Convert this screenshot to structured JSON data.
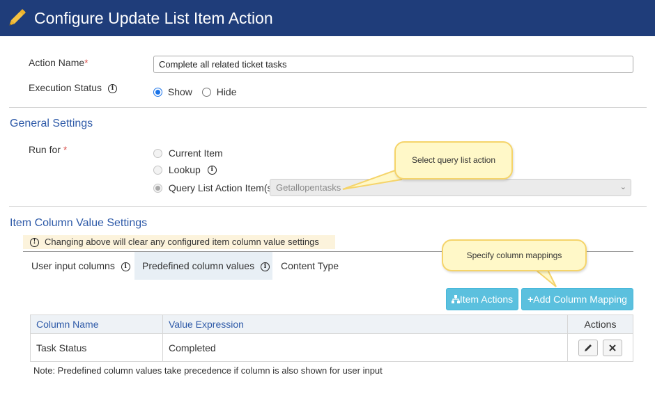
{
  "header": {
    "title": "Configure Update List Item Action",
    "icon": "pencil-icon"
  },
  "action_name": {
    "label": "Action Name",
    "required_mark": "*",
    "value": "Complete all related ticket tasks"
  },
  "execution_status": {
    "label": "Execution Status",
    "options": [
      "Show",
      "Hide"
    ],
    "selected": "Show"
  },
  "general_settings": {
    "title": "General Settings",
    "run_for": {
      "label": "Run for",
      "required_mark": "*",
      "options": [
        "Current Item",
        "Lookup",
        "Query List Action Item(s)"
      ],
      "selected": "Query List Action Item(s)"
    },
    "query_select": {
      "value": "Getallopentasks"
    }
  },
  "callouts": {
    "query": "Select query list action",
    "mapping": "Specify column mappings"
  },
  "item_column": {
    "title": "Item Column Value Settings",
    "warning": "Changing above will clear any configured item column value settings",
    "tabs": [
      "User input columns",
      "Predefined column values",
      "Content Type"
    ],
    "active_tab": "Predefined column values",
    "buttons": {
      "item_actions": "Item Actions",
      "add_mapping": "Add Column Mapping"
    },
    "table": {
      "headers": [
        "Column Name",
        "Value Expression",
        "Actions"
      ],
      "rows": [
        {
          "column": "Task Status",
          "value": "Completed"
        }
      ]
    },
    "note": "Note: Predefined column values take precedence if column is also shown for user input"
  },
  "colors": {
    "header_bg": "#1f3d7a",
    "section_title": "#2e5aa8",
    "button": "#5bc0de",
    "callout_bg": "#fff8c8",
    "callout_border": "#f5d46a"
  }
}
